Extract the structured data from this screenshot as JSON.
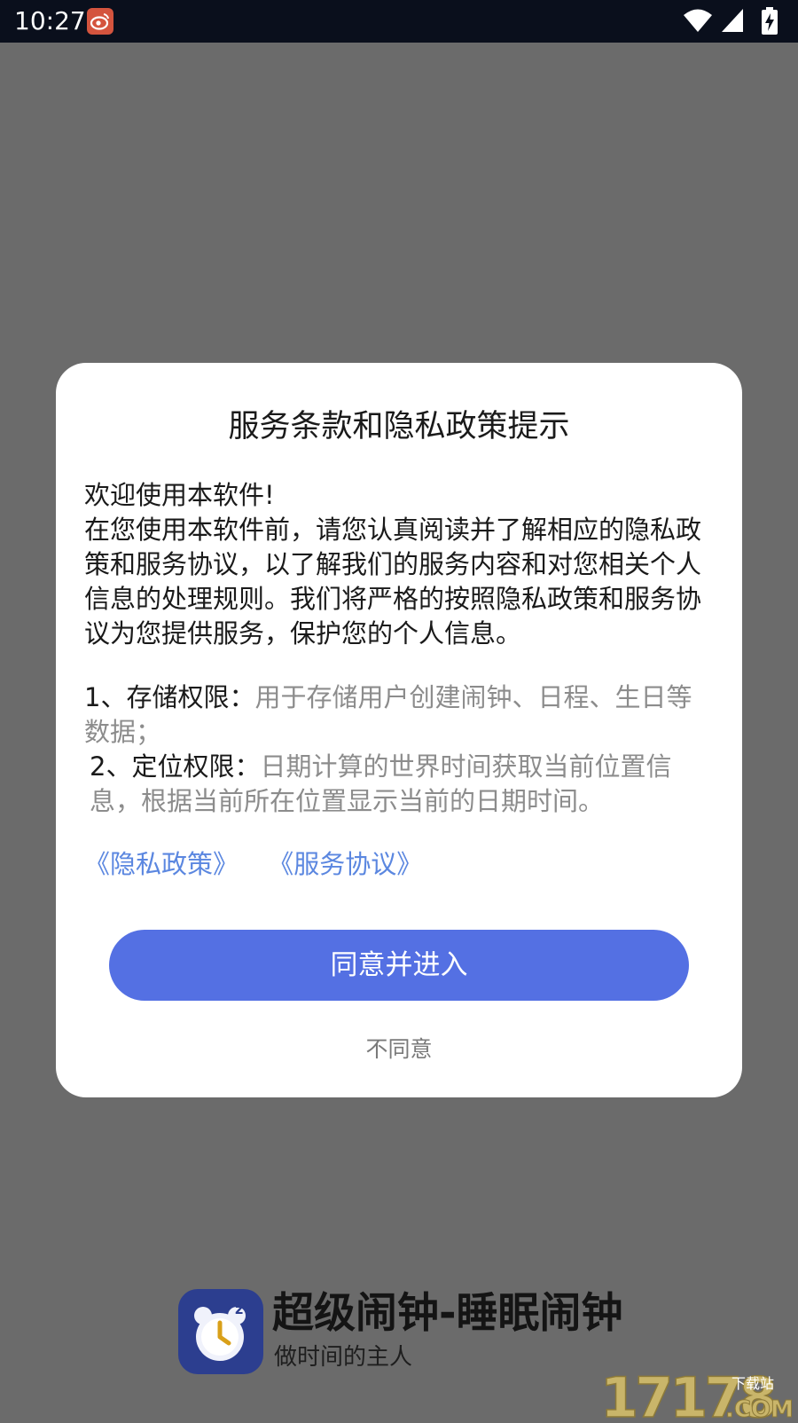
{
  "status_bar": {
    "time": "10:27",
    "app_icon": "weibo-icon",
    "icons": [
      "wifi-icon",
      "cell-signal-icon",
      "battery-charging-icon"
    ]
  },
  "dialog": {
    "title": "服务条款和隐私政策提示",
    "intro_lines": [
      "欢迎使用本软件!",
      "在您使用本软件前，请您认真阅读并了解相应的隐私政策和服务协议，以了解我们的服务内容和对您相关个人信息的处理规则。我们将严格的按照隐私政策和服务协议为您提供服务，保护您的个人信息。"
    ],
    "permissions": [
      {
        "label": "1、存储权限：",
        "desc": "用于存储用户创建闹钟、日程、生日等数据；"
      },
      {
        "label": "2、定位权限：",
        "desc": "日期计算的世界时间获取当前位置信息，根据当前所在位置显示当前的日期时间。"
      }
    ],
    "links": {
      "privacy": "《隐私政策》",
      "service": "《服务协议》"
    },
    "agree_label": "同意并进入",
    "disagree_label": "不同意"
  },
  "brand": {
    "name": "超级闹钟-睡眠闹钟",
    "slogan": "做时间的主人",
    "logo_icon": "alarm-clock-icon"
  },
  "watermark": {
    "text": "17178",
    "sub_text": "下载站",
    "suffix": ".COM"
  },
  "colors": {
    "overlay": "#6b6b6b",
    "accent": "#5470e3",
    "link": "#5b87e0",
    "muted_text": "#8c8c8c"
  }
}
